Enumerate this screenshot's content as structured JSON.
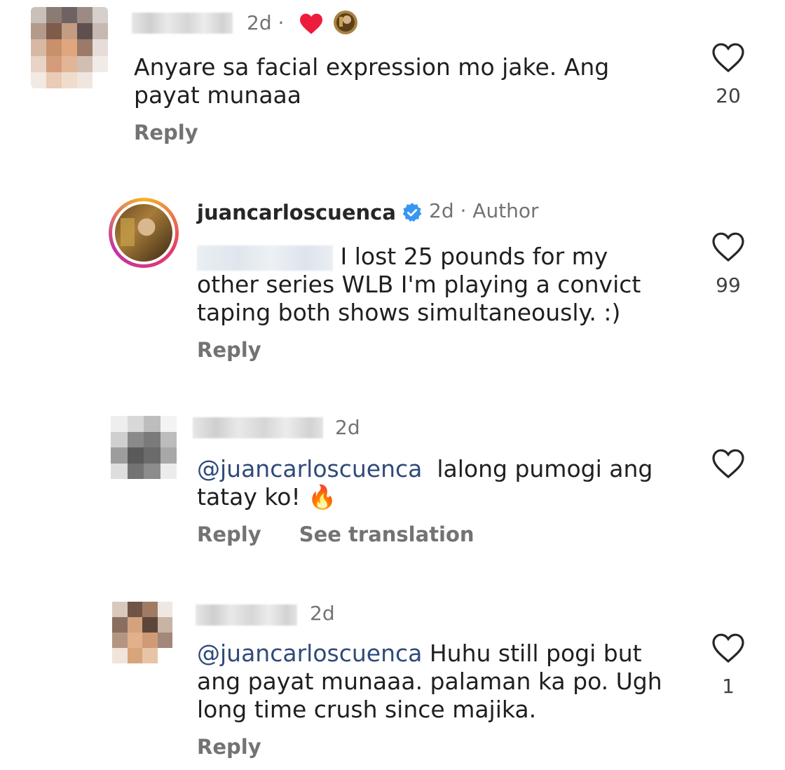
{
  "comments": [
    {
      "time": "2d ·",
      "text": "Anyare sa facial expression mo jake. Ang payat munaaa",
      "reply": "Reply",
      "likes": "20",
      "liked_by_author": true
    },
    {
      "username": "juancarloscuenca",
      "verified": true,
      "time": "2d",
      "author_label": "· Author",
      "text": "I lost 25 pounds for my other series WLB I'm playing a convict taping both shows simultaneously. :)",
      "reply": "Reply",
      "likes": "99"
    },
    {
      "time": "2d",
      "mention": "@juancarloscuenca",
      "text": "lalong pumogi ang tatay ko! 🔥",
      "reply": "Reply",
      "see_translation": "See translation"
    },
    {
      "time": "2d",
      "mention": "@juancarloscuenca",
      "text": "Huhu still pogi but ang payat munaaa. palaman ka po. Ugh long time crush since majika.",
      "reply": "Reply",
      "likes": "1"
    }
  ],
  "colors": {
    "heart_red": "#ed1c3c",
    "verified_blue": "#3897f0",
    "mention_blue": "#2f4a7a",
    "meta_gray": "#737373"
  }
}
